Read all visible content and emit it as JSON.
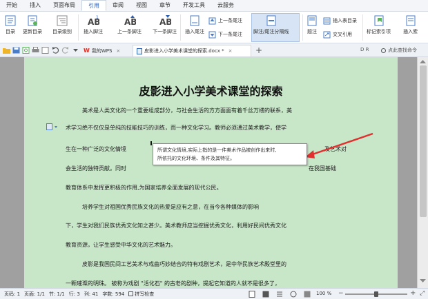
{
  "menubar": {
    "tabs": [
      "开始",
      "插入",
      "页面布局",
      "引用",
      "审阅",
      "视图",
      "章节",
      "开发工具",
      "云服务"
    ],
    "active": "引用"
  },
  "ribbon": {
    "toc": "目录",
    "update_toc": "更新目录",
    "toc_level": "目录级别",
    "insert_footnote": "插入脚注",
    "prev_footnote": "上一条脚注",
    "next_footnote": "下一条脚注",
    "insert_endnote": "插入尾注",
    "prev_endnote": "上一条尾注",
    "next_endnote": "下一条尾注",
    "footnote_separator": "脚注/尾注分隔线",
    "caption": "题注",
    "cross_reference": "交叉引用",
    "insert_toc_table": "插入表目录",
    "mark_index": "标记索引项",
    "insert_index": "插入索"
  },
  "quickbar": {
    "tab_mywps": "我的WPS",
    "doc_tab": "皮影进入小学美术课堂的探索.docx *",
    "search_placeholder": "点此查找命令",
    "right_letters": "D  R"
  },
  "document": {
    "title": "皮影进入小学美术课堂的探索",
    "lines": [
      "美术是人类文化的一个重要组成部分，与社会生活的方方面面有着千丝万缕的联系，美",
      "术学习绝不仅仅是单纯的技能技巧的训练，而一种文化学习。教师必须通过美术教学，使学",
      "生在一种广泛的文化情境",
      "会生活的独特贡献。同时",
      "教育体系中发挥更积极的作用,为国家培养全面发展的现代公民。",
      "培养学生对祖国优秀民族文化的热爱是应有之意，在当今各种媒体的影响",
      "下，学生对我们民族优秀文化知之甚少。美术教师应当挖掘优秀文化，利用好民间优秀文化",
      "教育资源，让学生感受中华文化的艺术魅力。",
      "皮影是我国民间工艺美术与戏曲巧妙结合的特有戏剧艺术，是中华民族艺术殿堂里的",
      "一颗璀璨的明珠。 被称为戏剧 \"活化石\" 的古老的剧种，提起它知道的人就不是很多了，"
    ],
    "line2_tail": "及艺术对",
    "line3_tail": "在我国基础"
  },
  "tooltip": {
    "line1": "所谓文化情境,实际上指的是一件美术作品被创作出来时,",
    "line2": "所依托的文化环境、条件及其特征。"
  },
  "statusbar": {
    "page": "页码: 1",
    "pages": "页面: 1/1",
    "section": "节: 1/1",
    "row": "行: 3",
    "column": "列: 41",
    "words": "字数: 594",
    "spellcheck": "拼写检查",
    "zoom": "100 %"
  },
  "colors": {
    "page_bg": "#c8e6c8",
    "accent": "#2b5fb4",
    "annotation_arrow": "#e03030"
  }
}
